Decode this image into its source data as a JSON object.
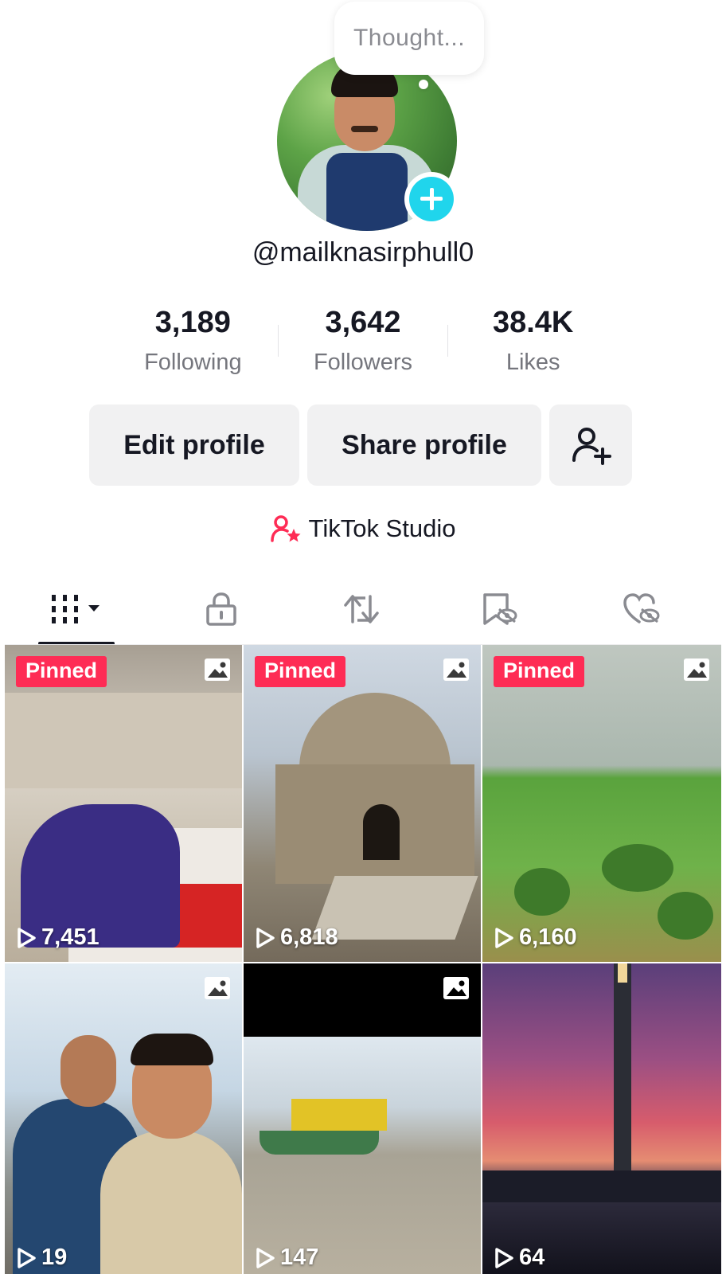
{
  "profile": {
    "thought": "Thought...",
    "username": "@mailknasirphull0"
  },
  "stats": [
    {
      "value": "3,189",
      "label": "Following"
    },
    {
      "value": "3,642",
      "label": "Followers"
    },
    {
      "value": "38.4K",
      "label": "Likes"
    }
  ],
  "actions": {
    "edit_label": "Edit profile",
    "share_label": "Share profile",
    "add_friend_icon": "add-friend-icon"
  },
  "studio": {
    "label": "TikTok Studio",
    "icon": "studio-star-person-icon",
    "accent": "#fe2c55"
  },
  "tabs": [
    {
      "icon": "grid-videos-icon",
      "selected": true
    },
    {
      "icon": "lock-icon",
      "selected": false
    },
    {
      "icon": "repost-icon",
      "selected": false
    },
    {
      "icon": "favorites-hidden-icon",
      "selected": false
    },
    {
      "icon": "liked-hidden-icon",
      "selected": false
    }
  ],
  "grid": [
    {
      "pinned": "Pinned",
      "views": "7,451",
      "photo": true
    },
    {
      "pinned": "Pinned",
      "views": "6,818",
      "photo": true
    },
    {
      "pinned": "Pinned",
      "views": "6,160",
      "photo": true
    },
    {
      "pinned": "",
      "views": "19",
      "photo": true
    },
    {
      "pinned": "",
      "views": "147",
      "photo": true
    },
    {
      "pinned": "",
      "views": "64",
      "photo": false
    }
  ],
  "colors": {
    "pinned_bg": "#fe2c55",
    "badge": "#20d5ec",
    "button_bg": "#f1f1f2",
    "text": "#161823",
    "muted": "#75767d"
  }
}
